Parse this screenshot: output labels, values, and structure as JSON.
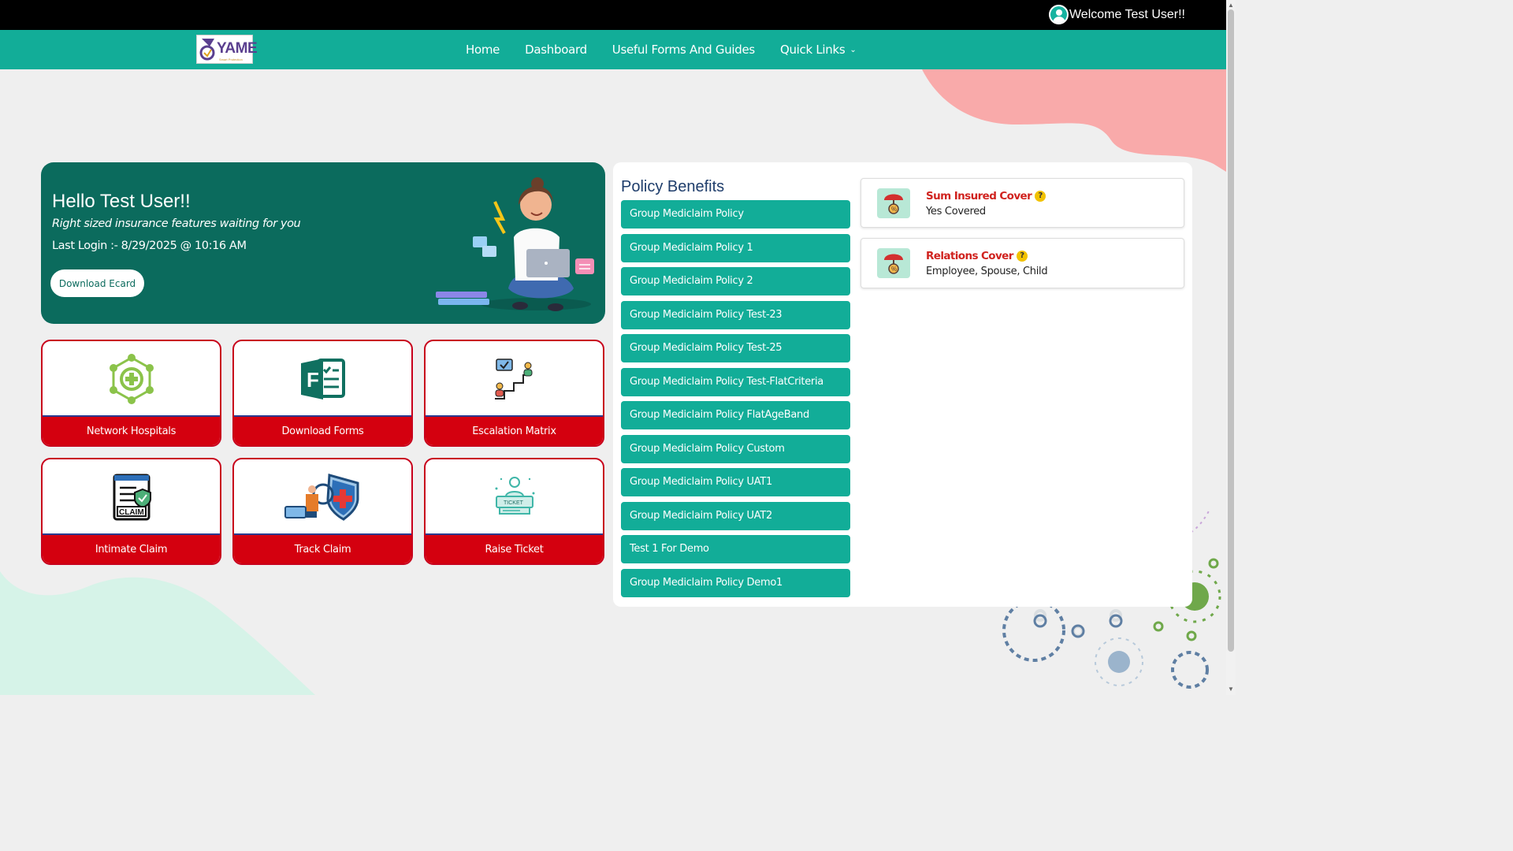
{
  "header": {
    "welcome": "Welcome Test User!!"
  },
  "logo": {
    "word": "YAME",
    "tagline": "Smart Protection"
  },
  "nav": {
    "items": [
      {
        "label": "Home"
      },
      {
        "label": "Dashboard"
      },
      {
        "label": "Useful Forms And Guides"
      },
      {
        "label": "Quick Links"
      }
    ]
  },
  "hero": {
    "greeting": "Hello Test User!!",
    "subtitle": "Right sized insurance features waiting for you",
    "last_login": "Last Login :- 8/29/2025 @ 10:16 AM",
    "button": "Download Ecard"
  },
  "tiles": [
    {
      "label": "Network Hospitals",
      "icon": "network-hospitals-icon"
    },
    {
      "label": "Download Forms",
      "icon": "forms-icon"
    },
    {
      "label": "Escalation Matrix",
      "icon": "escalation-icon"
    },
    {
      "label": "Intimate Claim",
      "icon": "claim-document-icon"
    },
    {
      "label": "Track Claim",
      "icon": "track-claim-icon"
    },
    {
      "label": "Raise Ticket",
      "icon": "ticket-icon"
    }
  ],
  "benefits": {
    "title": "Policy Benefits",
    "policies": [
      "Group Mediclaim Policy",
      "Group Mediclaim Policy 1",
      "Group Mediclaim Policy 2",
      "Group Mediclaim Policy Test-23",
      "Group Mediclaim Policy Test-25",
      "Group Mediclaim Policy Test-FlatCriteria",
      "Group Mediclaim Policy FlatAgeBand",
      "Group Mediclaim Policy Custom",
      "Group Mediclaim Policy UAT1",
      "Group Mediclaim Policy UAT2",
      "Test 1 For Demo",
      "Group Mediclaim Policy Demo1"
    ],
    "covers": [
      {
        "title": "Sum Insured Cover",
        "value": "Yes Covered"
      },
      {
        "title": "Relations Cover",
        "value": "Employee, Spouse, Child"
      }
    ],
    "help_mark": "?"
  },
  "colors": {
    "teal": "#12ad98",
    "dark_teal": "#0b6b5d",
    "red": "#d4000f",
    "topbar": "#000000"
  }
}
